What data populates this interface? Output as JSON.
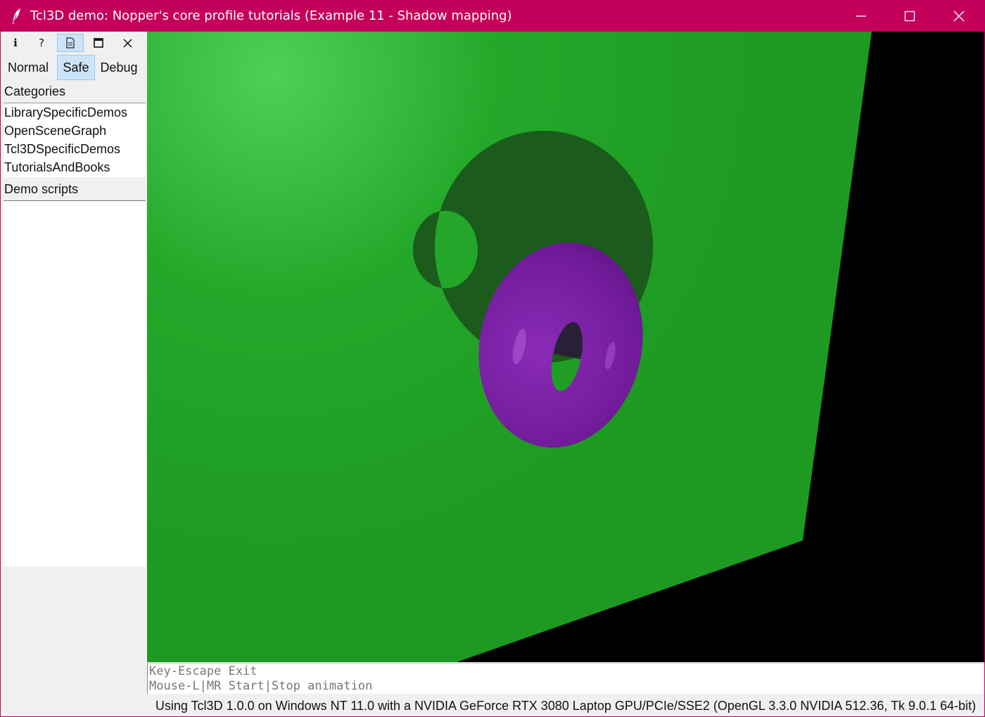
{
  "window": {
    "title": "Tcl3D demo: Nopper's core profile tutorials (Example 11 - Shadow mapping)",
    "accent_color": "#c4015a"
  },
  "toolbar": {
    "icons": [
      {
        "name": "info-icon",
        "glyph": "i"
      },
      {
        "name": "help-icon",
        "glyph": "?"
      },
      {
        "name": "document-icon",
        "glyph": "▤",
        "active": true
      },
      {
        "name": "fullscreen-icon",
        "glyph": "□"
      },
      {
        "name": "close-icon",
        "glyph": "✕"
      }
    ],
    "modes": {
      "normal": "Normal",
      "safe": "Safe",
      "debug": "Debug",
      "selected": "Safe"
    }
  },
  "sidebar": {
    "categories_label": "Categories",
    "categories": [
      "LibrarySpecificDemos",
      "OpenSceneGraph",
      "Tcl3DSpecificDemos",
      "TutorialsAndBooks"
    ],
    "demo_scripts_label": "Demo scripts",
    "demo_scripts": []
  },
  "scene": {
    "plane_color": "#22a526",
    "shadow_color": "#1b5b1c",
    "torus_color": "#7a1fa0",
    "background_color": "#000000"
  },
  "info": {
    "line1": "Key-Escape Exit",
    "line2": "Mouse-L|MR Start|Stop animation"
  },
  "status": "Using Tcl3D 1.0.0 on Windows NT 11.0 with a NVIDIA GeForce RTX 3080 Laptop GPU/PCIe/SSE2 (OpenGL 3.3.0 NVIDIA 512.36, Tk 9.0.1 64-bit)"
}
